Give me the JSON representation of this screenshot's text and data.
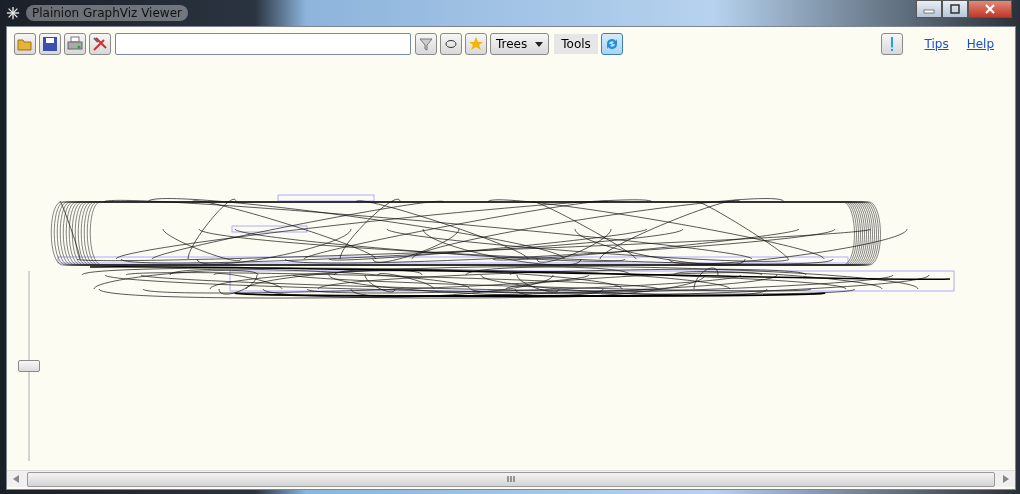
{
  "window": {
    "title": "Plainion GraphViz Viewer"
  },
  "toolbar": {
    "dropdown": {
      "label": "Trees"
    },
    "tools_button": {
      "label": "Tools"
    },
    "refresh_toggle": {
      "on": true
    },
    "links": [
      "Tips",
      "Help"
    ]
  },
  "zoom_slider": {
    "level": 0.5
  }
}
